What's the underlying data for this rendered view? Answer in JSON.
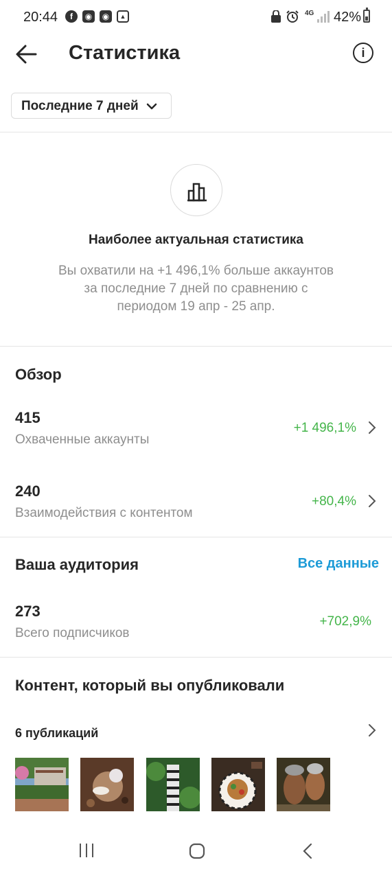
{
  "status_bar": {
    "time": "20:44",
    "battery": "42%",
    "network": "4G",
    "battery_level": 0.42
  },
  "header": {
    "title": "Статистика"
  },
  "period_selector": {
    "label": "Последние 7 дней"
  },
  "highlight": {
    "title": "Наиболее актуальная статистика",
    "text_line1": "Вы охватили на +1 496,1% больше аккаунтов",
    "text_line2": "за последние 7 дней по сравнению с",
    "text_line3": "периодом 19 апр - 25 апр."
  },
  "overview": {
    "title": "Обзор",
    "items": [
      {
        "value": "415",
        "label": "Охваченные аккаунты",
        "change": "+1 496,1%"
      },
      {
        "value": "240",
        "label": "Взаимодействия с контентом",
        "change": "+80,4%"
      }
    ]
  },
  "audience": {
    "title": "Ваша аудитория",
    "link": "Все данные",
    "value": "273",
    "label": "Всего подписчиков",
    "change": "+702,9%"
  },
  "content": {
    "title": "Контент, который вы опубликовали",
    "publications": "6 публикаций"
  },
  "colors": {
    "positive": "#44b54a",
    "link": "#1d9bd7",
    "text": "#262626",
    "secondary": "#8e8e8e"
  }
}
